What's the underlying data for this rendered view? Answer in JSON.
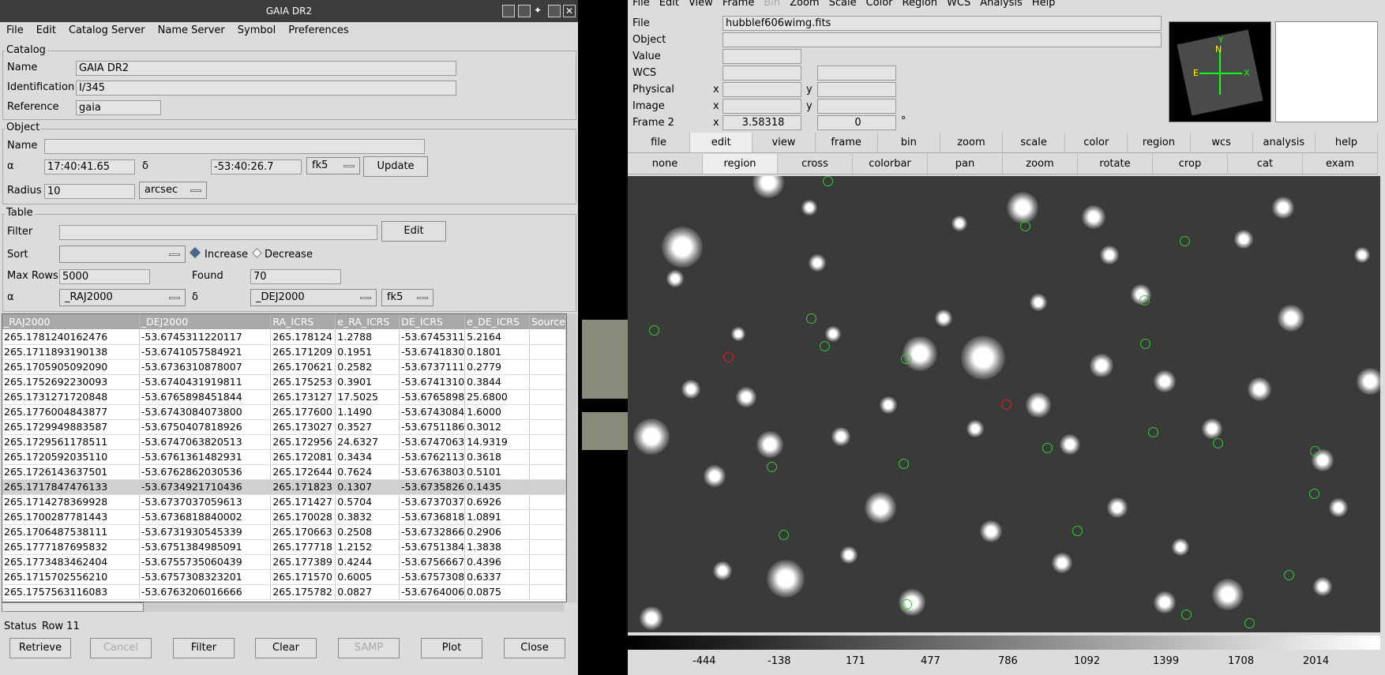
{
  "catalog_window": {
    "title": "GAIA DR2",
    "menu": [
      "File",
      "Edit",
      "Catalog Server",
      "Name Server",
      "Symbol",
      "Preferences"
    ],
    "catalog": {
      "section": "Catalog",
      "name_label": "Name",
      "name": "GAIA DR2",
      "id_label": "Identification",
      "id": "I/345",
      "ref_label": "Reference",
      "ref": "gaia"
    },
    "object": {
      "section": "Object",
      "name_label": "Name",
      "name": "",
      "alpha_label": "α",
      "alpha": "17:40:41.65",
      "delta_label": "δ",
      "delta": "-53:40:26.7",
      "system": "fk5",
      "update": "Update",
      "radius_label": "Radius",
      "radius": "10",
      "radius_unit": "arcsec"
    },
    "table_sect": {
      "section": "Table",
      "filter_label": "Filter",
      "filter": "",
      "edit": "Edit",
      "sort_label": "Sort",
      "sort": "",
      "increase": "Increase",
      "decrease": "Decrease",
      "maxrows_label": "Max Rows",
      "maxrows": "5000",
      "found_label": "Found",
      "found": "70",
      "alpha_label": "α",
      "alpha_col": "_RAJ2000",
      "delta_label": "δ",
      "delta_col": "_DEJ2000",
      "system": "fk5"
    },
    "columns": [
      "_RAJ2000",
      "_DEJ2000",
      "RA_ICRS",
      "e_RA_ICRS",
      "DE_ICRS",
      "e_DE_ICRS",
      "Source"
    ],
    "rows": [
      [
        "265.1781240162476",
        "-53.6745311220117",
        "265.178124",
        "1.2788",
        "-53.6745311",
        "5.2164",
        ""
      ],
      [
        "265.1711893190138",
        "-53.6741057584921",
        "265.171209",
        "0.1951",
        "-53.6741830",
        "0.1801",
        ""
      ],
      [
        "265.1705905092090",
        "-53.6736310878007",
        "265.170621",
        "0.2582",
        "-53.6737111",
        "0.2779",
        ""
      ],
      [
        "265.1752692230093",
        "-53.6740431919811",
        "265.175253",
        "0.3901",
        "-53.6741310",
        "0.3844",
        ""
      ],
      [
        "265.1731271720848",
        "-53.6765898451844",
        "265.173127",
        "17.5025",
        "-53.6765898",
        "25.6800",
        ""
      ],
      [
        "265.1776004843877",
        "-53.6743084073800",
        "265.177600",
        "1.1490",
        "-53.6743084",
        "1.6000",
        ""
      ],
      [
        "265.1729949883587",
        "-53.6750407818926",
        "265.173027",
        "0.3527",
        "-53.6751186",
        "0.3012",
        ""
      ],
      [
        "265.1729561178511",
        "-53.6747063820513",
        "265.172956",
        "24.6327",
        "-53.6747063",
        "14.9319",
        ""
      ],
      [
        "265.1720592035110",
        "-53.6761361482931",
        "265.172081",
        "0.3434",
        "-53.6762113",
        "0.3618",
        ""
      ],
      [
        "265.1726143637501",
        "-53.6762862030536",
        "265.172644",
        "0.7624",
        "-53.6763803",
        "0.5101",
        ""
      ],
      [
        "265.1717847476133",
        "-53.6734921710436",
        "265.171823",
        "0.1307",
        "-53.6735826",
        "0.1435",
        ""
      ],
      [
        "265.1714278369928",
        "-53.6737037059613",
        "265.171427",
        "0.5704",
        "-53.6737037",
        "0.6926",
        ""
      ],
      [
        "265.1700287781443",
        "-53.6736818840002",
        "265.170028",
        "0.3832",
        "-53.6736818",
        "1.0891",
        ""
      ],
      [
        "265.1706487538111",
        "-53.6731930545339",
        "265.170663",
        "0.2508",
        "-53.6732866",
        "0.2906",
        ""
      ],
      [
        "265.1777187695832",
        "-53.6751384985091",
        "265.177718",
        "1.2152",
        "-53.6751384",
        "1.3838",
        ""
      ],
      [
        "265.1773483462404",
        "-53.6755735060439",
        "265.177389",
        "0.4244",
        "-53.6756667",
        "0.4396",
        ""
      ],
      [
        "265.1715702556210",
        "-53.6757308323201",
        "265.171570",
        "0.6005",
        "-53.6757308",
        "0.6337",
        ""
      ],
      [
        "265.1757563116083",
        "-53.6763206016666",
        "265.175782",
        "0.0827",
        "-53.6764006",
        "0.0875",
        ""
      ]
    ],
    "status_label": "Status",
    "status": "Row 11",
    "buttons": [
      "Retrieve",
      "Cancel",
      "Filter",
      "Clear",
      "SAMP",
      "Plot",
      "Close"
    ]
  },
  "ds9": {
    "menu": [
      "File",
      "Edit",
      "View",
      "Frame",
      "Bin",
      "Zoom",
      "Scale",
      "Color",
      "Region",
      "WCS",
      "Analysis",
      "Help"
    ],
    "info": {
      "file_label": "File",
      "file": "hubblef606wimg.fits",
      "object_label": "Object",
      "value_label": "Value",
      "wcs_label": "WCS",
      "physical_label": "Physical",
      "image_label": "Image",
      "frame_label": "Frame 2",
      "x": "x",
      "y": "y",
      "frame_x": "3.58318",
      "frame_y": "0",
      "deg": "°"
    },
    "panner": {
      "n": "N",
      "e": "E",
      "y": "Y",
      "x": "X"
    },
    "buttons1": [
      "file",
      "edit",
      "view",
      "frame",
      "bin",
      "zoom",
      "scale",
      "color",
      "region",
      "wcs",
      "analysis",
      "help"
    ],
    "buttons2": [
      "none",
      "region",
      "cross",
      "colorbar",
      "pan",
      "zoom",
      "rotate",
      "crop",
      "cat",
      "exam"
    ],
    "colorbar": [
      "-444",
      "-138",
      "171",
      "477",
      "786",
      "1092",
      "1399",
      "1708",
      "2014"
    ]
  }
}
